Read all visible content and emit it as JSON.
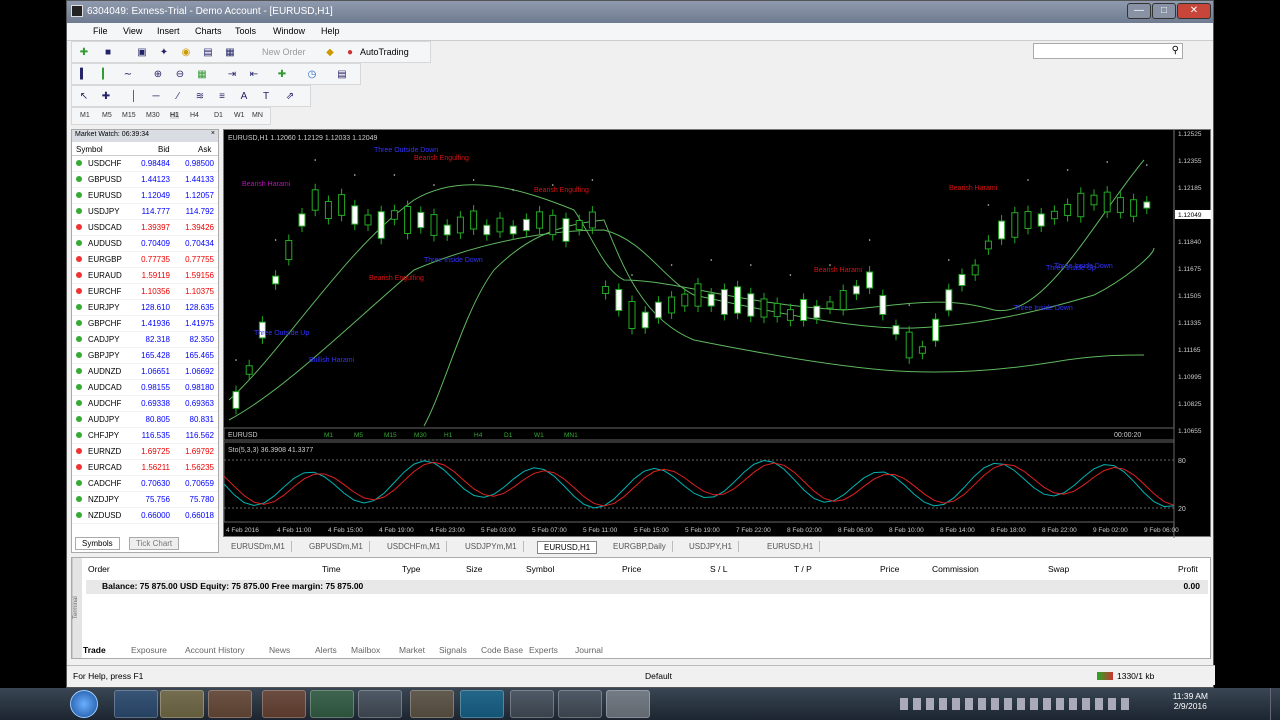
{
  "window": {
    "title": "6304049: Exness-Trial - Demo Account - [EURUSD,H1]"
  },
  "menu": [
    "File",
    "View",
    "Insert",
    "Charts",
    "Tools",
    "Window",
    "Help"
  ],
  "toolbar": {
    "new_order": "New Order",
    "autotrading": "AutoTrading"
  },
  "timeframes": [
    "M1",
    "M5",
    "M15",
    "M30",
    "H1",
    "H4",
    "D1",
    "W1",
    "MN"
  ],
  "market_watch": {
    "title": "Market Watch: 06:39:34",
    "columns": [
      "Symbol",
      "Bid",
      "Ask"
    ],
    "rows": [
      {
        "symbol": "USDCHF",
        "bid": "0.98484",
        "ask": "0.98500",
        "dir": "up"
      },
      {
        "symbol": "GBPUSD",
        "bid": "1.44123",
        "ask": "1.44133",
        "dir": "up"
      },
      {
        "symbol": "EURUSD",
        "bid": "1.12049",
        "ask": "1.12057",
        "dir": "up"
      },
      {
        "symbol": "USDJPY",
        "bid": "114.777",
        "ask": "114.792",
        "dir": "up"
      },
      {
        "symbol": "USDCAD",
        "bid": "1.39397",
        "ask": "1.39426",
        "dir": "down"
      },
      {
        "symbol": "AUDUSD",
        "bid": "0.70409",
        "ask": "0.70434",
        "dir": "up"
      },
      {
        "symbol": "EURGBP",
        "bid": "0.77735",
        "ask": "0.77755",
        "dir": "down"
      },
      {
        "symbol": "EURAUD",
        "bid": "1.59119",
        "ask": "1.59156",
        "dir": "down"
      },
      {
        "symbol": "EURCHF",
        "bid": "1.10356",
        "ask": "1.10375",
        "dir": "down"
      },
      {
        "symbol": "EURJPY",
        "bid": "128.610",
        "ask": "128.635",
        "dir": "up"
      },
      {
        "symbol": "GBPCHF",
        "bid": "1.41936",
        "ask": "1.41975",
        "dir": "up"
      },
      {
        "symbol": "CADJPY",
        "bid": "82.318",
        "ask": "82.350",
        "dir": "up"
      },
      {
        "symbol": "GBPJPY",
        "bid": "165.428",
        "ask": "165.465",
        "dir": "up"
      },
      {
        "symbol": "AUDNZD",
        "bid": "1.06651",
        "ask": "1.06692",
        "dir": "up"
      },
      {
        "symbol": "AUDCAD",
        "bid": "0.98155",
        "ask": "0.98180",
        "dir": "up"
      },
      {
        "symbol": "AUDCHF",
        "bid": "0.69338",
        "ask": "0.69363",
        "dir": "up"
      },
      {
        "symbol": "AUDJPY",
        "bid": "80.805",
        "ask": "80.831",
        "dir": "up"
      },
      {
        "symbol": "CHFJPY",
        "bid": "116.535",
        "ask": "116.562",
        "dir": "up"
      },
      {
        "symbol": "EURNZD",
        "bid": "1.69725",
        "ask": "1.69792",
        "dir": "down"
      },
      {
        "symbol": "EURCAD",
        "bid": "1.56211",
        "ask": "1.56235",
        "dir": "down"
      },
      {
        "symbol": "CADCHF",
        "bid": "0.70630",
        "ask": "0.70659",
        "dir": "up"
      },
      {
        "symbol": "NZDJPY",
        "bid": "75.756",
        "ask": "75.780",
        "dir": "up"
      },
      {
        "symbol": "NZDUSD",
        "bid": "0.66000",
        "ask": "0.66018",
        "dir": "up"
      }
    ],
    "tabs": [
      "Symbols",
      "Tick Chart"
    ]
  },
  "chart": {
    "header": "EURUSD,H1  1.12060 1.12129 1.12033 1.12049",
    "price_labels": [
      "1.12525",
      "1.12355",
      "1.12185",
      "1.12049",
      "1.11840",
      "1.11675",
      "1.11505",
      "1.11335",
      "1.11165",
      "1.10995",
      "1.10825",
      "1.10655"
    ],
    "date_labels": [
      "4 Feb 2016",
      "4 Feb 11:00",
      "4 Feb 15:00",
      "4 Feb 19:00",
      "4 Feb 23:00",
      "5 Feb 03:00",
      "5 Feb 07:00",
      "5 Feb 11:00",
      "5 Feb 15:00",
      "5 Feb 19:00",
      "7 Feb 22:00",
      "8 Feb 02:00",
      "8 Feb 06:00",
      "8 Feb 10:00",
      "8 Feb 14:00",
      "8 Feb 18:00",
      "8 Feb 22:00",
      "9 Feb 02:00",
      "9 Feb 06:00"
    ],
    "pattern_labels": [
      "Three Outside Down",
      "Bearish Engulfing",
      "Bearish Harami",
      "Bearish Harami",
      "Bearish Engulfing",
      "Three Outside Up",
      "Three Outside Up",
      "Three Inside Down",
      "Three Inside Down",
      "Three Inside Down",
      "Three Inside Up",
      "Bearish Engulfing",
      "Bullish Harami",
      "Bearish Harami"
    ],
    "strip_label": "EURUSD",
    "strip_tf": [
      "M1",
      "M5",
      "M15",
      "M30",
      "H1",
      "H4",
      "D1",
      "W1",
      "MN1"
    ],
    "strip_time": "00:00:20",
    "stoch_label": "Sto(5,3,3) 36.3908 41.3377",
    "stoch_levels": [
      "80",
      "20"
    ]
  },
  "chart_tabs": [
    "EURUSDm,M1",
    "GBPUSDm,M1",
    "USDCHFm,M1",
    "USDJPYm,M1",
    "EURUSD,H1",
    "EURGBP,Daily",
    "USDJPY,H1",
    "EURUSD,H1"
  ],
  "terminal": {
    "columns": [
      "Order",
      "Time",
      "Type",
      "Size",
      "Symbol",
      "Price",
      "S / L",
      "T / P",
      "Price",
      "Commission",
      "Swap",
      "Profit"
    ],
    "balance_row": "Balance: 75 875.00 USD  Equity: 75 875.00  Free margin: 75 875.00",
    "profit": "0.00",
    "side_label": "Terminal",
    "tabs": [
      "Trade",
      "Exposure",
      "Account History",
      "News",
      "Alerts",
      "Mailbox",
      "Market",
      "Signals",
      "Code Base",
      "Experts",
      "Journal"
    ]
  },
  "status": {
    "help": "For Help, press F1",
    "profile": "Default",
    "conn": "1330/1 kb"
  },
  "clock": {
    "time": "11:39 AM",
    "date": "2/9/2016"
  }
}
